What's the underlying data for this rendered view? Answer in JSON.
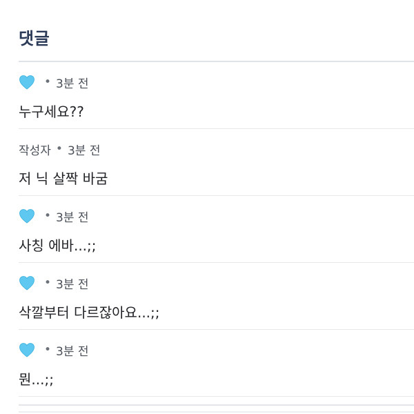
{
  "section": {
    "title": "댓글"
  },
  "comments": [
    {
      "author_icon": "light-blue-heart-icon",
      "author": "",
      "separator": "•",
      "time": "3분 전",
      "text": "누구세요??"
    },
    {
      "author_icon": "",
      "author": "작성자",
      "separator": "•",
      "time": "3분 전",
      "text": "저 닉 살짝 바굼"
    },
    {
      "author_icon": "light-blue-heart-icon",
      "author": "",
      "separator": "•",
      "time": "3분 전",
      "text": "사칭 에바...;;"
    },
    {
      "author_icon": "light-blue-heart-icon",
      "author": "",
      "separator": "•",
      "time": "3분 전",
      "text": "삭깔부터 다르잖아요...;;"
    },
    {
      "author_icon": "light-blue-heart-icon",
      "author": "",
      "separator": "•",
      "time": "3분 전",
      "text": "뭔...;;"
    }
  ],
  "colors": {
    "heart": "#5ec8f0",
    "title": "#2b3a57"
  }
}
